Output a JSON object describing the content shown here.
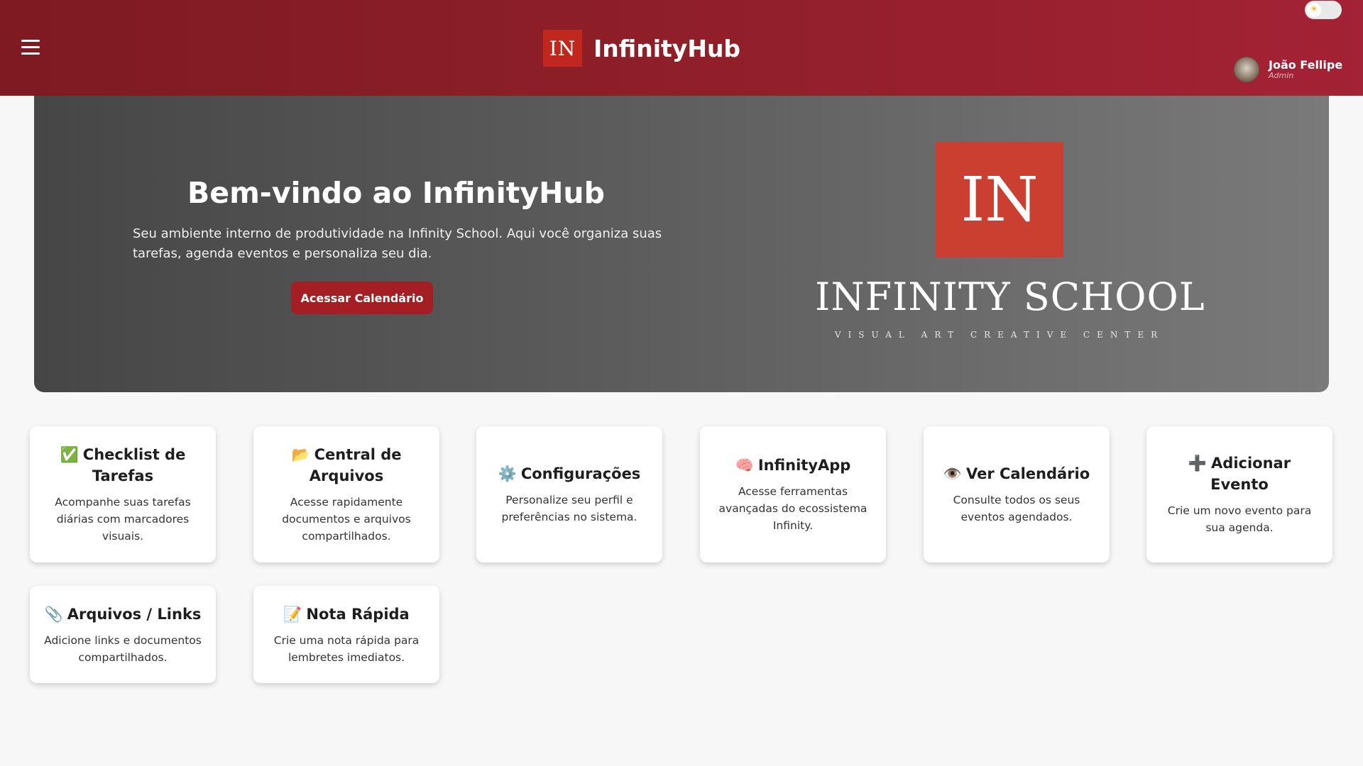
{
  "header": {
    "logo_text": "IN",
    "app_name": "InfinityHub",
    "theme_icon": "☀",
    "user": {
      "name": "João Fellipe",
      "role": "Admin"
    }
  },
  "hero": {
    "title": "Bem-vindo ao InfinityHub",
    "description": "Seu ambiente interno de produtividade na Infinity School. Aqui você organiza suas tarefas, agenda eventos e personaliza seu dia.",
    "button_label": "Acessar Calendário",
    "school_logo_text": "IN",
    "school_name": "INFINITY SCHOOL",
    "school_tagline": "VISUAL ART CREATIVE CENTER"
  },
  "cards": [
    {
      "icon": "✅",
      "title": "Checklist de Tarefas",
      "desc": "Acompanhe suas tarefas diárias com marcadores visuais."
    },
    {
      "icon": "📂",
      "title": "Central de Arquivos",
      "desc": "Acesse rapidamente documentos e arquivos compartilhados."
    },
    {
      "icon": "⚙️",
      "title": "Configurações",
      "desc": "Personalize seu perfil e preferências no sistema."
    },
    {
      "icon": "🧠",
      "title": "InfinityApp",
      "desc": "Acesse ferramentas avançadas do ecossistema Infinity."
    },
    {
      "icon": "👁️",
      "title": "Ver Calendário",
      "desc": "Consulte todos os seus eventos agendados."
    },
    {
      "icon": "➕",
      "title": "Adicionar Evento",
      "desc": "Crie um novo evento para sua agenda."
    },
    {
      "icon": "📎",
      "title": "Arquivos / Links",
      "desc": "Adicione links e documentos compartilhados."
    },
    {
      "icon": "📝",
      "title": "Nota Rápida",
      "desc": "Crie uma nota rápida para lembretes imediatos."
    }
  ],
  "colors": {
    "header_start": "#7e1a22",
    "header_end": "#a32235",
    "accent_button": "#a41f24",
    "school_logo": "#cb3f30"
  }
}
